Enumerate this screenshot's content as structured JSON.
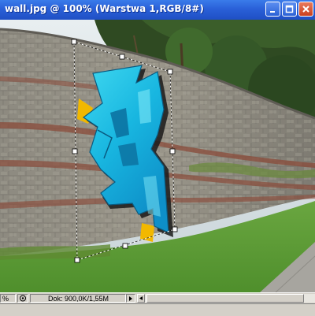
{
  "window": {
    "title": "wall.jpg @ 100% (Warstwa 1,RGB/8#)"
  },
  "status": {
    "zoom": "%",
    "doc_info": "Dok: 900,0K/1,55M"
  },
  "icons": {
    "minimize": "minimize-icon",
    "maximize": "maximize-icon",
    "close": "close-icon",
    "navigator": "navigator-icon",
    "menu_arrow": "triangle-right-icon",
    "scroll_left": "scroll-left-icon"
  },
  "colors": {
    "title_bar": "#2a60d8",
    "graffiti_fill": "#20c0e6",
    "graffiti_outline": "#f2b800",
    "transform_box": "#ffffff"
  }
}
